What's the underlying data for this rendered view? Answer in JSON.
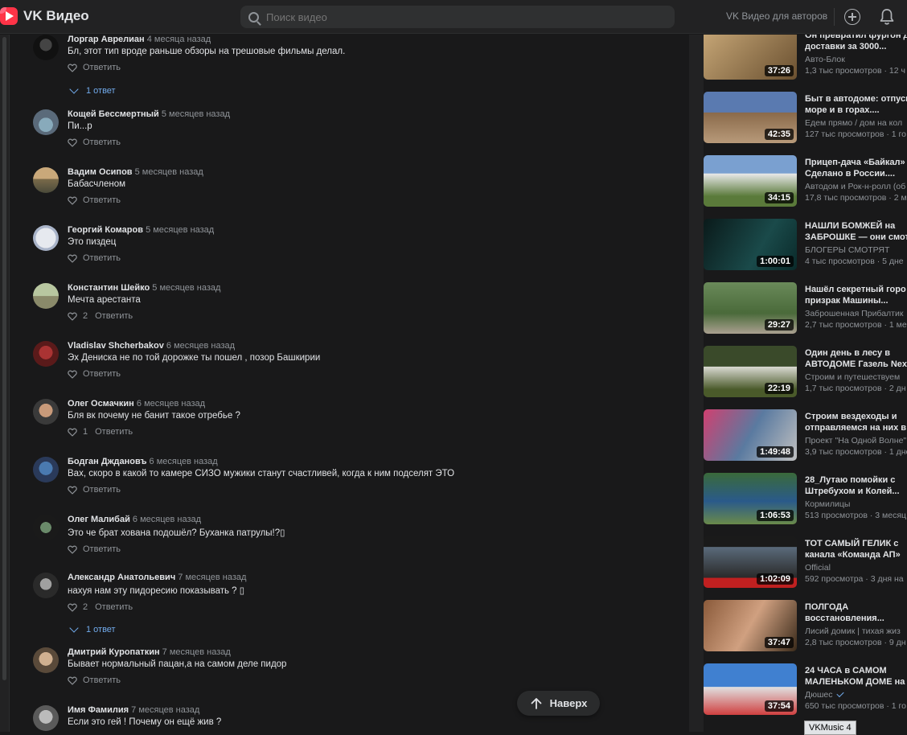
{
  "header": {
    "brand": "VK Видео",
    "search_placeholder": "Поиск видео",
    "for_authors": "VK Видео для авторов",
    "colors": {
      "accent": "#ff3347",
      "link": "#71aaeb",
      "bg": "#19191a"
    }
  },
  "comments": [
    {
      "author": "Лоргар Аврелиан",
      "time": "4 месяца назад",
      "text": "Бл, этот тип вроде раньше обзоры на трешовые фильмы делал.",
      "likes": "",
      "reply": "Ответить",
      "replies": "1 ответ"
    },
    {
      "author": "Кощей Бессмертный",
      "time": "5 месяцев назад",
      "text": "Пи...р",
      "likes": "",
      "reply": "Ответить",
      "replies": ""
    },
    {
      "author": "Вадим Осипов",
      "time": "5 месяцев назад",
      "text": "Бабасчленом",
      "likes": "",
      "reply": "Ответить",
      "replies": ""
    },
    {
      "author": "Георгий Комаров",
      "time": "5 месяцев назад",
      "text": "Это пиздец",
      "likes": "",
      "reply": "Ответить",
      "replies": ""
    },
    {
      "author": "Константин Шейко",
      "time": "5 месяцев назад",
      "text": "Мечта арестанта",
      "likes": "2",
      "reply": "Ответить",
      "replies": ""
    },
    {
      "author": "Vladislav Shcherbakov",
      "time": "6 месяцев назад",
      "text": "Эх Дениска не по той дорожке ты пошел , позор Башкирии",
      "likes": "",
      "reply": "Ответить",
      "replies": ""
    },
    {
      "author": "Олег Осмачкин",
      "time": "6 месяцев назад",
      "text": "Бля вк почему не банит такое отребье ?",
      "likes": "1",
      "reply": "Ответить",
      "replies": ""
    },
    {
      "author": "Бодган Дждановъ",
      "time": "6 месяцев назад",
      "text": "Вах, скоро в какой то камере СИЗО мужики станут счастливей, когда к ним подселят ЭТО",
      "likes": "",
      "reply": "Ответить",
      "replies": ""
    },
    {
      "author": "Олег Малибай",
      "time": "6 месяцев назад",
      "text": "Это че брат хована подошёл? Буханка патрулы!?▯",
      "likes": "",
      "reply": "Ответить",
      "replies": ""
    },
    {
      "author": "Александр Анатольевич",
      "time": "7 месяцев назад",
      "text": "нахуя нам эту пидоресию показывать ? ▯",
      "likes": "2",
      "reply": "Ответить",
      "replies": "1 ответ"
    },
    {
      "author": "Дмитрий Куропаткин",
      "time": "7 месяцев назад",
      "text": "Бывает нормальный пацан,а на самом деле пидор",
      "likes": "",
      "reply": "Ответить",
      "replies": ""
    },
    {
      "author": "Имя Фамилия",
      "time": "7 месяцев назад",
      "text": "Если это гей ! Почему он ещё жив ?",
      "likes": "",
      "reply": "",
      "replies": ""
    }
  ],
  "up_button": "Наверх",
  "recommendations": [
    {
      "title1": "Он превратил фургон д",
      "title2": "доставки за 3000...",
      "channel": "Авто-Блок",
      "meta": "1,3 тыс просмотров · 12 ч",
      "duration": "37:26",
      "verified": false
    },
    {
      "title1": "Быт в автодоме: отпуск",
      "title2": "море и в горах....",
      "channel": "Едем прямо / дом на кол",
      "meta": "127 тыс просмотров · 1 го",
      "duration": "42:35",
      "verified": false
    },
    {
      "title1": "Прицеп-дача «Байкал»",
      "title2": "Сделано в России....",
      "channel": "Автодом и Рок-н-ролл (об",
      "meta": "17,8 тыс просмотров · 2 м",
      "duration": "34:15",
      "verified": false
    },
    {
      "title1": "НАШЛИ БОМЖЕЙ на",
      "title2": "ЗАБРОШКЕ — они смот",
      "channel": "БЛОГЕРЫ СМОТРЯТ",
      "meta": "4 тыс просмотров · 5 дне",
      "duration": "1:00:01",
      "verified": false
    },
    {
      "title1": "Нашёл секретный горо",
      "title2": "призрак Машины...",
      "channel": "Заброшенная Прибалтик",
      "meta": "2,7 тыс просмотров · 1 ме",
      "duration": "29:27",
      "verified": false
    },
    {
      "title1": "Один день в лесу в",
      "title2": "АВТОДОМЕ Газель Next",
      "channel": "Строим и путешествуем",
      "meta": "1,7 тыс просмотров · 2 дн",
      "duration": "22:19",
      "verified": false
    },
    {
      "title1": "Строим вездеходы и",
      "title2": "отправляемся на них в",
      "channel": "Проект \"На Одной Волне\"",
      "meta": "3,9 тыс просмотров · 1 дне",
      "duration": "1:49:48",
      "verified": false
    },
    {
      "title1": "28_Лутаю помойки с",
      "title2": "Штребухом и Колей...",
      "channel": "Кормилицы",
      "meta": "513 просмотров · 3 месяц",
      "duration": "1:06:53",
      "verified": false
    },
    {
      "title1": "ТОТ САМЫЙ ГЕЛИК с",
      "title2": "канала «Команда АП»",
      "channel": "Official",
      "meta": "592 просмотра · 3 дня на",
      "duration": "1:02:09",
      "verified": false
    },
    {
      "title1": "ПОЛГОДА",
      "title2": "восстановления...",
      "channel": "Лисий домик | тихая жиз",
      "meta": "2,8 тыс просмотров · 9 дн",
      "duration": "37:47",
      "verified": false
    },
    {
      "title1": "24 ЧАСА в САМОМ",
      "title2": "МАЛЕНЬКОМ ДОМЕ на",
      "channel": "Дюшес",
      "meta": "650 тыс просмотров · 1 го",
      "duration": "37:54",
      "verified": true
    }
  ],
  "tooltip": "VKMusic 4"
}
